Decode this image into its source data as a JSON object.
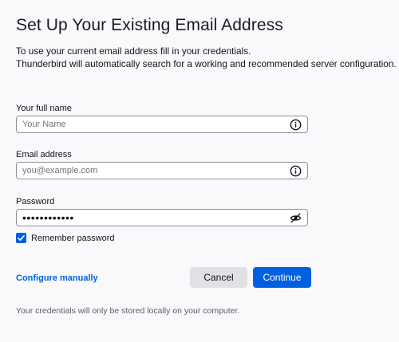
{
  "header": {
    "title": "Set Up Your Existing Email Address",
    "subtitle_line1": "To use your current email address fill in your credentials.",
    "subtitle_line2": "Thunderbird will automatically search for a working and recommended server configuration."
  },
  "form": {
    "name": {
      "label": "Your full name",
      "placeholder": "Your Name",
      "icon": "info-icon"
    },
    "email": {
      "label": "Email address",
      "placeholder": "you@example.com",
      "icon": "info-icon"
    },
    "password": {
      "label": "Password",
      "value": "••••••••••••",
      "icon": "eye-slash-icon"
    },
    "remember": {
      "label": "Remember password",
      "checked": true
    }
  },
  "actions": {
    "configure_manually": "Configure manually",
    "cancel": "Cancel",
    "continue": "Continue"
  },
  "footer": {
    "note": "Your credentials will only be stored locally on your computer."
  },
  "colors": {
    "accent": "#0061e0",
    "background": "#f9f9fb",
    "secondary_button": "#e0e0e6"
  }
}
